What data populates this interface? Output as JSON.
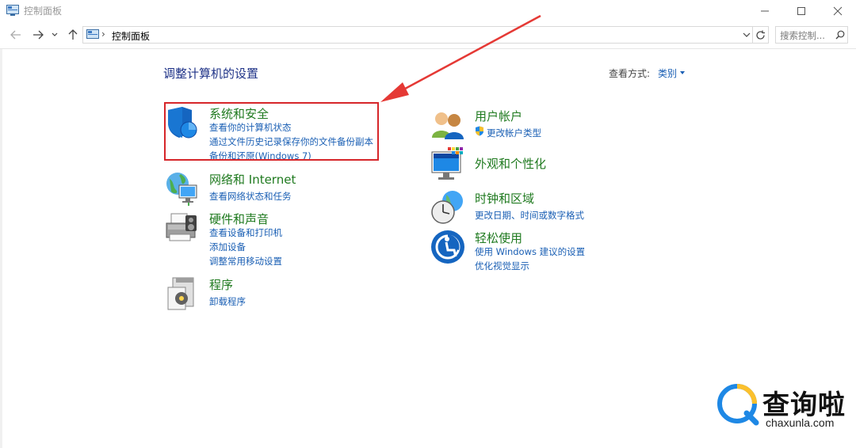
{
  "window": {
    "title": "控制面板"
  },
  "nav": {
    "breadcrumb": "控制面板",
    "search_placeholder": "搜索控制..."
  },
  "main": {
    "heading": "调整计算机的设置",
    "view_by_label": "查看方式:",
    "view_by_value": "类别"
  },
  "categories_left": [
    {
      "title": "系统和安全",
      "links": [
        "查看你的计算机状态",
        "通过文件历史记录保存你的文件备份副本",
        "备份和还原(Windows 7)"
      ]
    },
    {
      "title": "网络和 Internet",
      "links": [
        "查看网络状态和任务"
      ]
    },
    {
      "title": "硬件和声音",
      "links": [
        "查看设备和打印机",
        "添加设备",
        "调整常用移动设置"
      ]
    },
    {
      "title": "程序",
      "links": [
        "卸载程序"
      ]
    }
  ],
  "categories_right": [
    {
      "title": "用户帐户",
      "links": [
        "更改帐户类型"
      ]
    },
    {
      "title": "外观和个性化",
      "links": []
    },
    {
      "title": "时钟和区域",
      "links": [
        "更改日期、时间或数字格式"
      ]
    },
    {
      "title": "轻松使用",
      "links": [
        "使用 Windows 建议的设置",
        "优化视觉显示"
      ]
    }
  ],
  "watermark": {
    "text": "查询啦",
    "url": "chaxunla.com"
  },
  "colors": {
    "heading": "#1e3287",
    "category_title": "#1f7a1f",
    "link": "#1a5fb4",
    "highlight": "#d6262a"
  }
}
